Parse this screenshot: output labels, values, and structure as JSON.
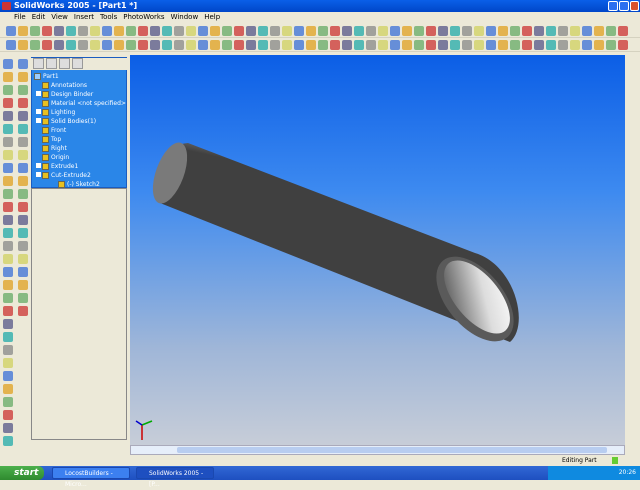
{
  "window": {
    "title": "SolidWorks 2005 - [Part1 *]"
  },
  "menu": [
    "File",
    "Edit",
    "View",
    "Insert",
    "Tools",
    "PhotoWorks",
    "Window",
    "Help"
  ],
  "tree": {
    "root": "Part1",
    "items": [
      {
        "label": "Annotations",
        "expand": false
      },
      {
        "label": "Design Binder",
        "expand": true
      },
      {
        "label": "Material <not specified>",
        "expand": false
      },
      {
        "label": "Lighting",
        "expand": true
      },
      {
        "label": "Solid Bodies(1)",
        "expand": true
      },
      {
        "label": "Front",
        "expand": false
      },
      {
        "label": "Top",
        "expand": false
      },
      {
        "label": "Right",
        "expand": false
      },
      {
        "label": "Origin",
        "expand": false
      },
      {
        "label": "Extrude1",
        "expand": true
      },
      {
        "label": "Cut-Extrude2",
        "expand": true
      },
      {
        "label": "(-) Sketch2",
        "expand": false
      }
    ]
  },
  "status": {
    "mode": "Editing Part"
  },
  "taskbar": {
    "start": "start",
    "tasks": [
      "LocostBuilders - Micro...",
      "SolidWorks 2005 - [P..."
    ],
    "clock": "20:26"
  },
  "colors": {
    "viewport_top": "#0b5ee6",
    "viewport_bottom": "#c7cdd8",
    "tree_bg": "#2a86e8"
  }
}
